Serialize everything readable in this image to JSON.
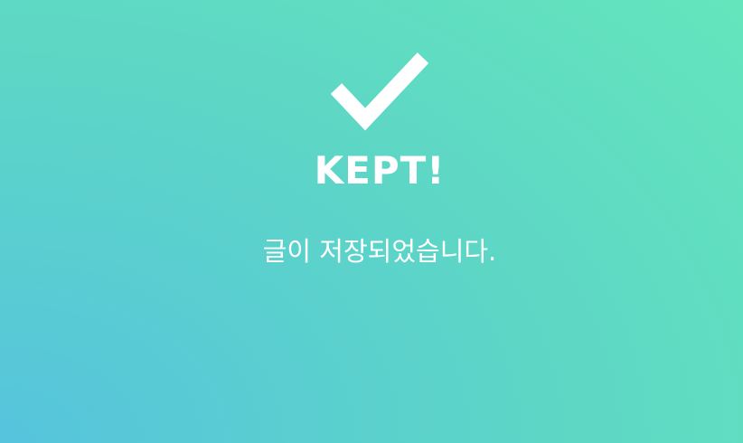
{
  "status": {
    "icon": "checkmark-icon",
    "title": "KEPT!",
    "message": "글이 저장되었습니다."
  },
  "colors": {
    "gradient_bottom_left": "#56c4dd",
    "gradient_top_right": "#64e6bb",
    "text": "#ffffff"
  }
}
